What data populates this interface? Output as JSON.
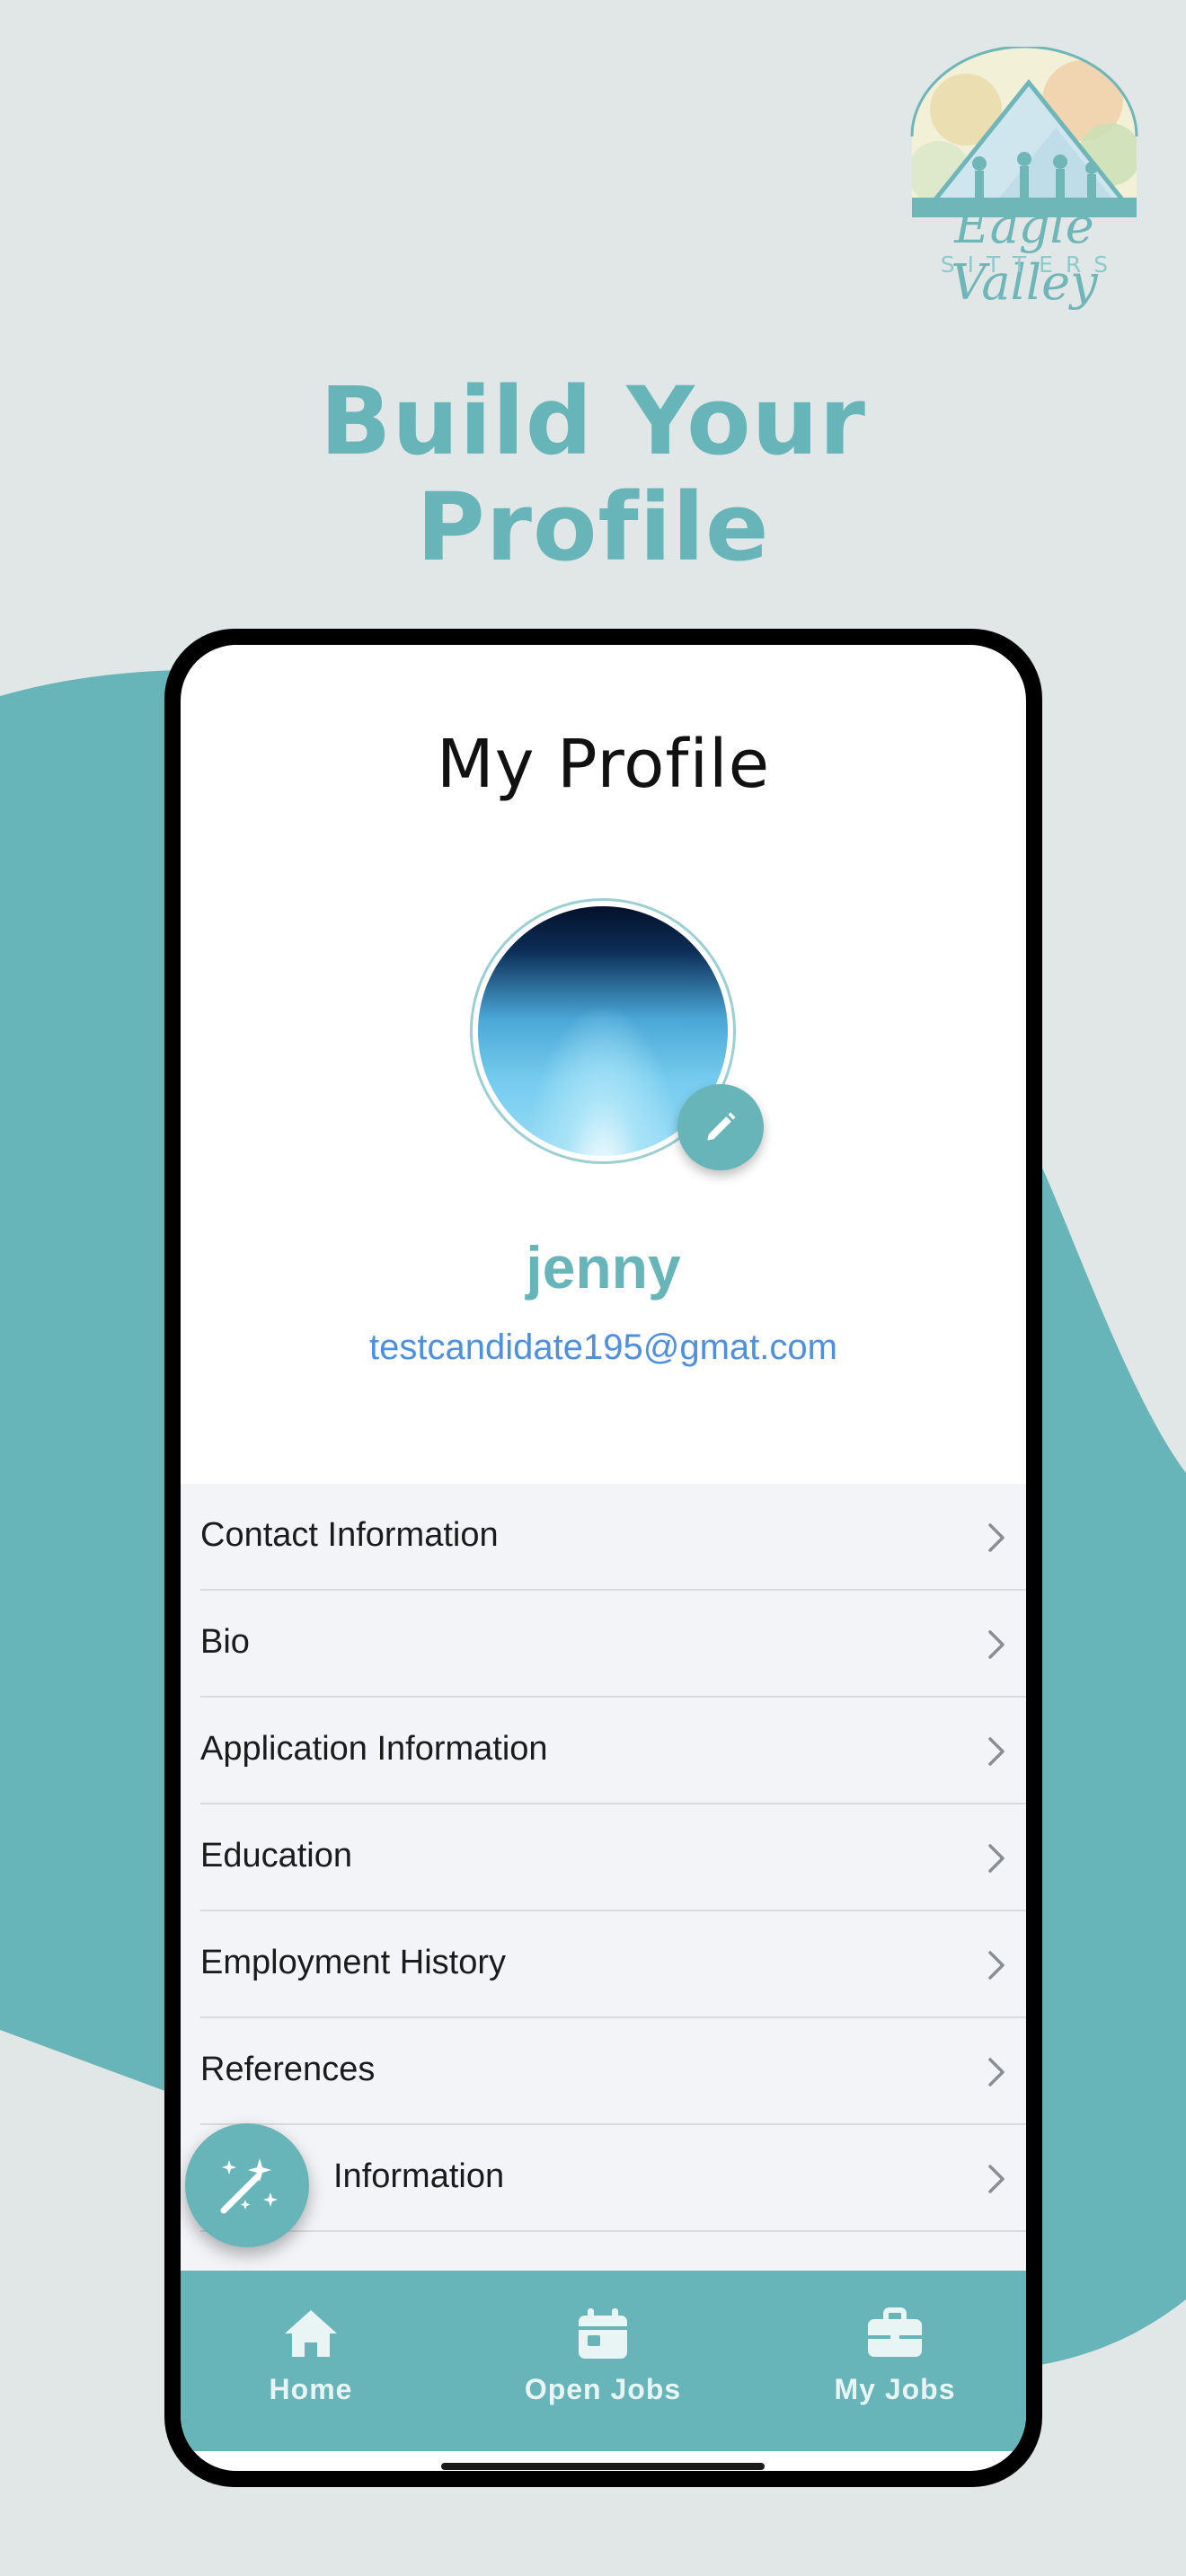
{
  "logo": {
    "line1": "Eagle Valley",
    "line2": "SITTERS"
  },
  "headline": "Build Your Profile",
  "screen": {
    "title": "My Profile",
    "user": {
      "name": "jenny",
      "email": "testcandidate195@gmat.com"
    },
    "menu": [
      {
        "label": "Contact Information"
      },
      {
        "label": "Bio"
      },
      {
        "label": "Application Information"
      },
      {
        "label": "Education"
      },
      {
        "label": "Employment History"
      },
      {
        "label": "References"
      },
      {
        "label": "Information"
      }
    ],
    "tabs": [
      {
        "label": "Home",
        "icon": "home-icon"
      },
      {
        "label": "Open Jobs",
        "icon": "calendar-icon"
      },
      {
        "label": "My Jobs",
        "icon": "briefcase-icon"
      }
    ]
  },
  "colors": {
    "background": "#e1e6e6",
    "accent": "#67b5b8",
    "email": "#4f8fe0",
    "menu_bg": "#f3f4f8"
  }
}
